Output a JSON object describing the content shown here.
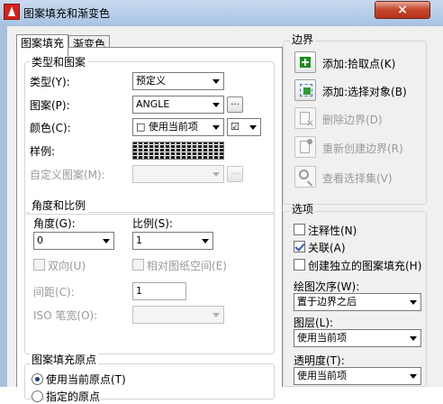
{
  "window": {
    "title": "图案填充和渐变色",
    "close_glyph": "×"
  },
  "tabs": [
    "图案填充",
    "渐变色"
  ],
  "pattern": {
    "section_title": "类型和图案",
    "type_label": "类型(Y):",
    "type_value": "预定义",
    "pattern_label": "图案(P):",
    "pattern_value": "ANGLE",
    "pattern_browse": "...",
    "color_label": "颜色(C):",
    "color_value": "□ 使用当前项",
    "color_extra": "☑",
    "sample_label": "样例:",
    "custom_label": "自定义图案(M):",
    "custom_browse": "..."
  },
  "angle": {
    "section_title": "角度和比例",
    "angle_label": "角度(G):",
    "angle_value": "0",
    "scale_label": "比例(S):",
    "scale_value": "1",
    "double_label": "双向(U)",
    "relative_label": "相对图纸空间(E)",
    "spacing_label": "间距(C):",
    "spacing_value": "1",
    "iso_label": "ISO 笔宽(O):"
  },
  "origin": {
    "section_title": "图案填充原点",
    "current_label": "使用当前原点(T)",
    "specified_label": "指定的原点"
  },
  "boundary": {
    "section_title": "边界",
    "add_pick": "添加:拾取点(K)",
    "add_select": "添加:选择对象(B)",
    "remove": "删除边界(D)",
    "recreate": "重新创建边界(R)",
    "view": "查看选择集(V)"
  },
  "options": {
    "section_title": "选项",
    "annotative": "注释性(N)",
    "associative": "关联(A)",
    "independent": "创建独立的图案填充(H)",
    "draw_order_label": "绘图次序(W):",
    "draw_order_value": "置于边界之后",
    "layer_label": "图层(L):",
    "layer_value": "使用当前项",
    "transparency_label": "透明度(T):",
    "transparency_value": "使用当前项"
  }
}
